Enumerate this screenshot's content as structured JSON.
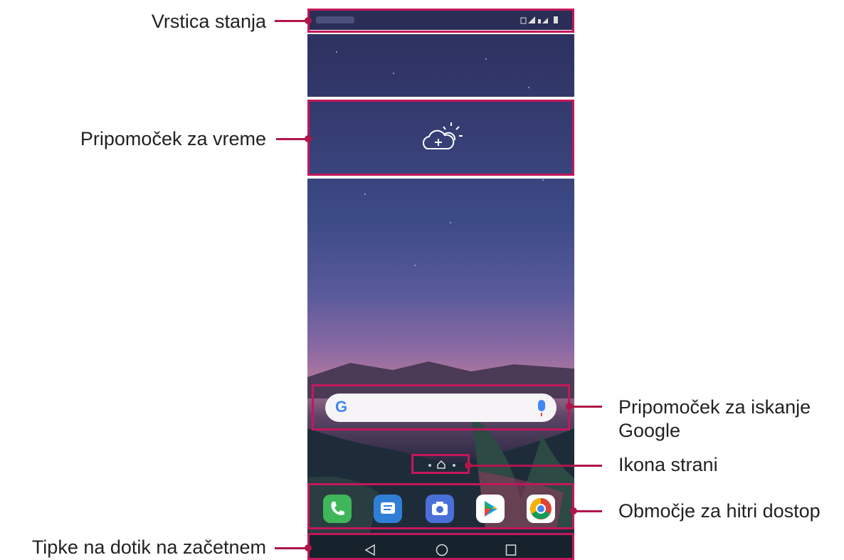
{
  "labels": {
    "status_bar": "Vrstica stanja",
    "weather_widget": "Pripomoček za vreme",
    "google_search_line1": "Pripomoček za iskanje",
    "google_search_line2": "Google",
    "page_icon": "Ikona strani",
    "quick_access": "Območje za hitri dostop",
    "home_touch_keys": "Tipke na dotik na začetnem"
  },
  "search": {
    "logo": "G"
  },
  "icons": {
    "weather": "cloud-sun-plus-icon",
    "dock": [
      "phone-icon",
      "messages-icon",
      "camera-icon",
      "play-store-icon",
      "chrome-icon"
    ],
    "nav": [
      "back-icon",
      "home-icon",
      "recents-icon"
    ]
  },
  "colors": {
    "callout": "#b0154a",
    "frame": "#c2185b"
  }
}
